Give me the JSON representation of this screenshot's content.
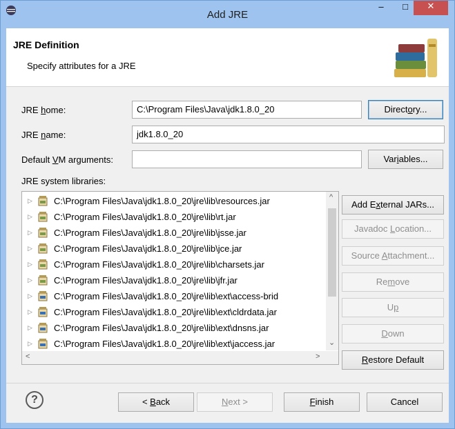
{
  "window": {
    "title": "Add JRE",
    "minimize_glyph": "–",
    "maximize_glyph": "□",
    "close_glyph": "✕"
  },
  "banner": {
    "title": "JRE Definition",
    "description": "Specify attributes for a JRE"
  },
  "form": {
    "jre_home_label_pre": "JRE ",
    "jre_home_label_mnemonic": "h",
    "jre_home_label_post": "ome:",
    "jre_home_value": "C:\\Program Files\\Java\\jdk1.8.0_20",
    "jre_name_label_pre": "JRE ",
    "jre_name_label_mnemonic": "n",
    "jre_name_label_post": "ame:",
    "jre_name_value": "jdk1.8.0_20",
    "vm_args_label_pre": "Default ",
    "vm_args_label_mnemonic": "V",
    "vm_args_label_post": "M arguments:",
    "vm_args_value": "",
    "libraries_label": "JRE system libraries:"
  },
  "buttons": {
    "directory_pre": "Direct",
    "directory_mnemonic": "o",
    "directory_post": "ry...",
    "variables_pre": "Var",
    "variables_mnemonic": "i",
    "variables_post": "ables...",
    "add_external_pre": "Add E",
    "add_external_mnemonic": "x",
    "add_external_post": "ternal JARs...",
    "javadoc_pre": "Javadoc ",
    "javadoc_mnemonic": "L",
    "javadoc_post": "ocation...",
    "source_pre": "Source ",
    "source_mnemonic": "A",
    "source_post": "ttachment...",
    "remove_pre": "Re",
    "remove_mnemonic": "m",
    "remove_post": "ove",
    "up_pre": "U",
    "up_mnemonic": "p",
    "up_post": "",
    "down_pre": "",
    "down_mnemonic": "D",
    "down_post": "own",
    "restore_pre": "",
    "restore_mnemonic": "R",
    "restore_post": "estore Default",
    "back_pre": "< ",
    "back_mnemonic": "B",
    "back_post": "ack",
    "next_pre": "",
    "next_mnemonic": "N",
    "next_post": "ext >",
    "finish_pre": "",
    "finish_mnemonic": "F",
    "finish_post": "inish",
    "cancel": "Cancel",
    "help_glyph": "?"
  },
  "libraries": [
    {
      "path": "C:\\Program Files\\Java\\jdk1.8.0_20\\jre\\lib\\resources.jar",
      "icon": "jar-icon"
    },
    {
      "path": "C:\\Program Files\\Java\\jdk1.8.0_20\\jre\\lib\\rt.jar",
      "icon": "jar-icon"
    },
    {
      "path": "C:\\Program Files\\Java\\jdk1.8.0_20\\jre\\lib\\jsse.jar",
      "icon": "jar-icon"
    },
    {
      "path": "C:\\Program Files\\Java\\jdk1.8.0_20\\jre\\lib\\jce.jar",
      "icon": "jar-icon"
    },
    {
      "path": "C:\\Program Files\\Java\\jdk1.8.0_20\\jre\\lib\\charsets.jar",
      "icon": "jar-icon"
    },
    {
      "path": "C:\\Program Files\\Java\\jdk1.8.0_20\\jre\\lib\\jfr.jar",
      "icon": "jar-icon"
    },
    {
      "path": "C:\\Program Files\\Java\\jdk1.8.0_20\\jre\\lib\\ext\\access-brid",
      "icon": "binary-jar-icon"
    },
    {
      "path": "C:\\Program Files\\Java\\jdk1.8.0_20\\jre\\lib\\ext\\cldrdata.jar",
      "icon": "binary-jar-icon"
    },
    {
      "path": "C:\\Program Files\\Java\\jdk1.8.0_20\\jre\\lib\\ext\\dnsns.jar",
      "icon": "binary-jar-icon"
    },
    {
      "path": "C:\\Program Files\\Java\\jdk1.8.0_20\\jre\\lib\\ext\\jaccess.jar",
      "icon": "binary-jar-icon"
    }
  ],
  "scroll_glyphs": {
    "up": "^",
    "down": "⌄",
    "left": "<",
    "right": ">",
    "expand": "▷"
  },
  "colors": {
    "titlebar": "#9dc3ee",
    "close": "#c75050",
    "default_border": "#3c7fb1"
  }
}
